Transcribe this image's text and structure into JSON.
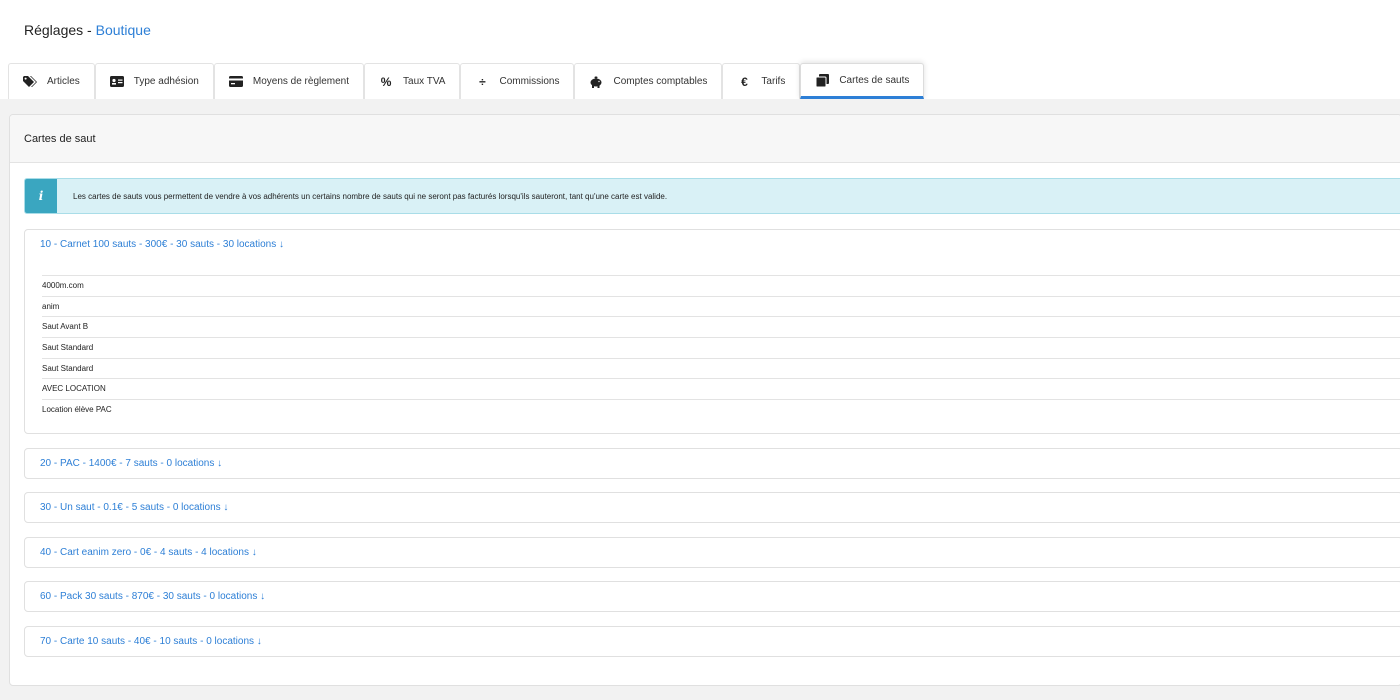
{
  "header": {
    "title": "Réglages",
    "separator": " - ",
    "section": "Boutique"
  },
  "tabs": [
    {
      "label": "Articles",
      "icon": "tags-icon"
    },
    {
      "label": "Type adhésion",
      "icon": "id-card-icon"
    },
    {
      "label": "Moyens de règlement",
      "icon": "credit-card-icon"
    },
    {
      "label": "Taux TVA",
      "icon": "percent-icon"
    },
    {
      "label": "Commissions",
      "icon": "divide-icon"
    },
    {
      "label": "Comptes comptables",
      "icon": "piggy-bank-icon"
    },
    {
      "label": "Tarifs",
      "icon": "euro-icon"
    },
    {
      "label": "Cartes de sauts",
      "icon": "clone-icon",
      "active": true
    }
  ],
  "card": {
    "title": "Cartes de saut",
    "alert": "Les cartes de sauts vous permettent de vendre à vos adhérents un certains nombre de sauts qui ne seront pas facturés lorsqu'ils sauteront, tant qu'une carte est valide."
  },
  "panels": [
    {
      "title": "10 - Carnet 100 sauts - 300€ - 30 sauts - 30 locations ↓",
      "items": [
        "4000m.com",
        "anim",
        "Saut Avant B",
        "Saut Standard",
        "Saut Standard",
        "AVEC LOCATION",
        "Location élève PAC"
      ]
    },
    {
      "title": "20 - PAC - 1400€ - 7 sauts - 0 locations ↓"
    },
    {
      "title": "30 - Un saut - 0.1€ - 5 sauts - 0 locations ↓"
    },
    {
      "title": "40 - Cart eanim zero - 0€ - 4 sauts - 4 locations ↓"
    },
    {
      "title": "60 - Pack 30 sauts - 870€ - 30 sauts - 0 locations ↓"
    },
    {
      "title": "70 - Carte 10 sauts - 40€ - 10 sauts - 0 locations ↓"
    }
  ],
  "colors": {
    "accent": "#2d7fd6",
    "info_bg": "#d9f1f6",
    "info_icon": "#3aa6c0"
  }
}
